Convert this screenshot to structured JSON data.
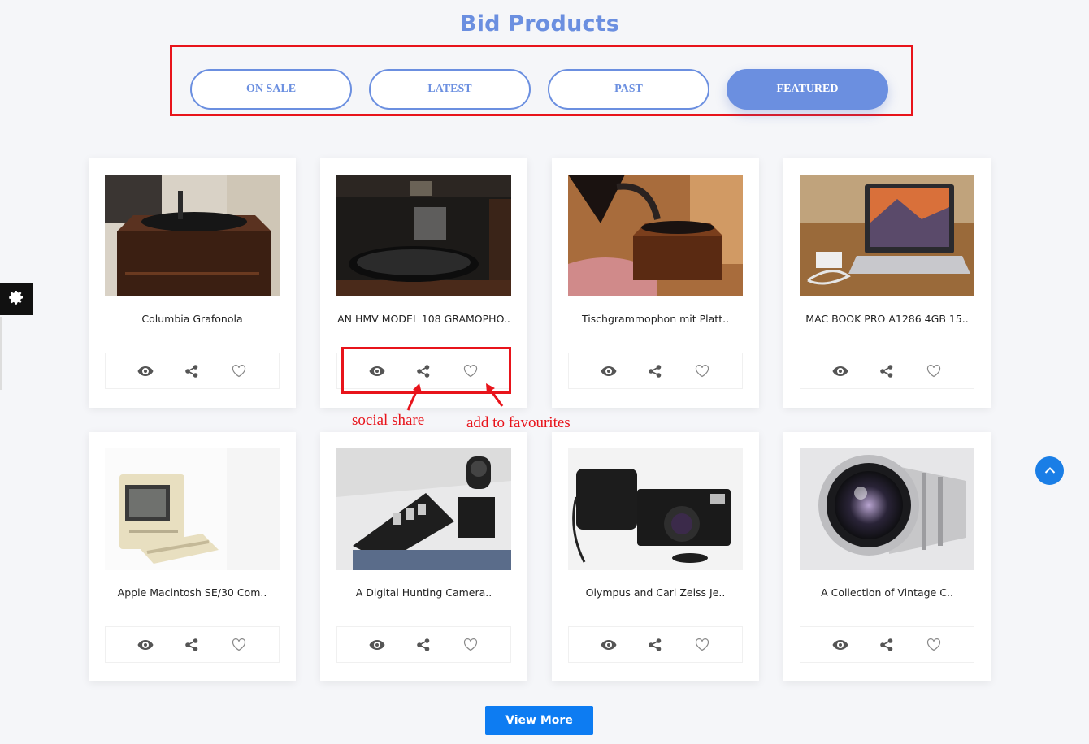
{
  "section": {
    "title": "Bid Products"
  },
  "tabs": [
    {
      "label": "ON SALE",
      "active": false
    },
    {
      "label": "LATEST",
      "active": false
    },
    {
      "label": "PAST",
      "active": false
    },
    {
      "label": "FEATURED",
      "active": true
    }
  ],
  "products": [
    {
      "title": "Columbia Grafonola"
    },
    {
      "title": "AN HMV MODEL 108 GRAMOPHO.."
    },
    {
      "title": "Tischgrammophon mit Platt.."
    },
    {
      "title": "MAC BOOK PRO A1286 4GB 15.."
    },
    {
      "title": "Apple Macintosh SE/30 Com.."
    },
    {
      "title": "A Digital Hunting Camera.."
    },
    {
      "title": "Olympus and Carl Zeiss Je.."
    },
    {
      "title": "A Collection of Vintage C.."
    }
  ],
  "annotations": {
    "share": "social share",
    "favourites": "add to favourites"
  },
  "buttons": {
    "view_more": "View More"
  },
  "icons": {
    "settings": "gear-icon",
    "view": "eye-icon",
    "share": "share-icon",
    "favourite": "heart-icon",
    "scroll_top": "chevron-up-icon"
  },
  "colors": {
    "accent": "#6b8fe0",
    "annotation": "#e8141b",
    "primary_button": "#0d7cf2",
    "scroll_top": "#1a7ee6"
  }
}
